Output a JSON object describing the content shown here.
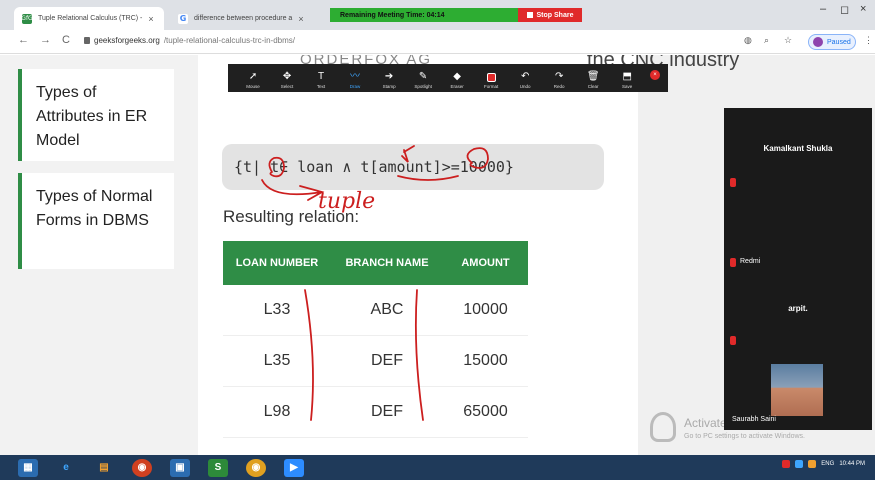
{
  "browser": {
    "tabs": [
      {
        "favicon": "GfG",
        "title": "Tuple Relational Calculus (TRC) - ",
        "close": "×"
      },
      {
        "favicon": "G",
        "title": "difference between procedure a",
        "close": "×"
      }
    ],
    "meeting_timer": "Remaining Meeting Time: 04:14",
    "stop_share": "Stop Share",
    "window_controls": [
      "–",
      "◻",
      "×"
    ],
    "nav": {
      "back": "←",
      "forward": "→",
      "reload": "C"
    },
    "url_host": "geeksforgeeks.org",
    "url_path": "/tuple-relational-calculus-trc-in-dbms/",
    "profile_status": "Paused"
  },
  "sidebar": {
    "items": [
      {
        "label": "Types of Attributes in ER Model"
      },
      {
        "label": "Types of Normal Forms in DBMS"
      }
    ]
  },
  "background_texts": {
    "cnc": "the CNC industry",
    "heading": "ORDERFOX AG"
  },
  "annotation_toolbar": {
    "tools": [
      {
        "icon": "arrow-icon",
        "glyph": "➚",
        "label": "Mouse"
      },
      {
        "icon": "select-icon",
        "glyph": "✥",
        "label": "Select"
      },
      {
        "icon": "text-icon",
        "glyph": "T",
        "label": "Text"
      },
      {
        "icon": "draw-icon",
        "glyph": "〰",
        "label": "Draw"
      },
      {
        "icon": "stamp-icon",
        "glyph": "➔",
        "label": "Stamp"
      },
      {
        "icon": "spotlight-icon",
        "glyph": "✎",
        "label": "Spotlight"
      },
      {
        "icon": "eraser-icon",
        "glyph": "◆",
        "label": "Eraser"
      },
      {
        "icon": "format-icon",
        "glyph": "",
        "label": "Format"
      },
      {
        "icon": "undo-icon",
        "glyph": "↶",
        "label": "Undo"
      },
      {
        "icon": "redo-icon",
        "glyph": "↷",
        "label": "Redo"
      },
      {
        "icon": "clear-icon",
        "glyph": "🗑",
        "label": "Clear"
      },
      {
        "icon": "save-icon",
        "glyph": "⬒",
        "label": "Save"
      }
    ],
    "active_tool": "Draw"
  },
  "content": {
    "formula": "{t| t∈ loan  ∧ t[amount]>=10000}",
    "result_label": "Resulting relation:",
    "table": {
      "headers": [
        "LOAN NUMBER",
        "BRANCH NAME",
        "AMOUNT"
      ],
      "rows": [
        [
          "L33",
          "ABC",
          "10000"
        ],
        [
          "L35",
          "DEF",
          "15000"
        ],
        [
          "L98",
          "DEF",
          "65000"
        ]
      ]
    },
    "handwriting": "tuple"
  },
  "video_panel": {
    "participants": [
      "Kamalkant Shukla",
      "Redmi",
      "arpit."
    ],
    "speaker_label": "Saurabh Saini"
  },
  "watermark": {
    "title": "Activate Windows",
    "subtitle": "Go to PC settings to activate Windows."
  },
  "taskbar": {
    "tray_time": "10:44 PM",
    "tray_lang": "ENG"
  },
  "colors": {
    "gfg_green": "#2f8d46",
    "ink_red": "#cc1f1f",
    "meeting_green": "#2dad32"
  }
}
